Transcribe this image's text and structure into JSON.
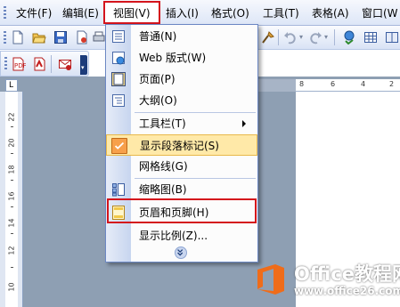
{
  "menubar": {
    "items": [
      {
        "label": "文件(F)"
      },
      {
        "label": "编辑(E)"
      },
      {
        "label": "视图(V)"
      },
      {
        "label": "插入(I)"
      },
      {
        "label": "格式(O)"
      },
      {
        "label": "工具(T)"
      },
      {
        "label": "表格(A)"
      },
      {
        "label": "窗口(W"
      }
    ]
  },
  "view_menu": {
    "items": [
      {
        "label": "普通(N)",
        "icon": "normal-view-icon"
      },
      {
        "label": "Web 版式(W)",
        "icon": "web-layout-icon"
      },
      {
        "label": "页面(P)",
        "icon": "print-layout-icon"
      },
      {
        "label": "大纲(O)",
        "icon": "outline-icon"
      },
      {
        "label": "工具栏(T)",
        "has_submenu": true
      },
      {
        "label": "显示段落标记(S)",
        "icon": "check-icon",
        "checked": true
      },
      {
        "label": "网格线(G)"
      },
      {
        "label": "缩略图(B)",
        "icon": "thumbnails-icon"
      },
      {
        "label": "页眉和页脚(H)",
        "icon": "header-footer-icon"
      },
      {
        "label": "显示比例(Z)..."
      }
    ]
  },
  "rulers": {
    "horizontal": [
      "8",
      "6",
      "4",
      "2"
    ],
    "vertical": [
      "22",
      "20",
      "18",
      "16",
      "14",
      "12",
      "10"
    ]
  },
  "watermark": {
    "brand": "Office教程网",
    "url": "www.office26.com"
  },
  "colors": {
    "highlight_box": "#d4141c",
    "menu_border": "#6c88c4",
    "selected_item": "#ffe9a8",
    "workspace": "#8e9fb3",
    "logo_orange": "#ef6c1a"
  }
}
